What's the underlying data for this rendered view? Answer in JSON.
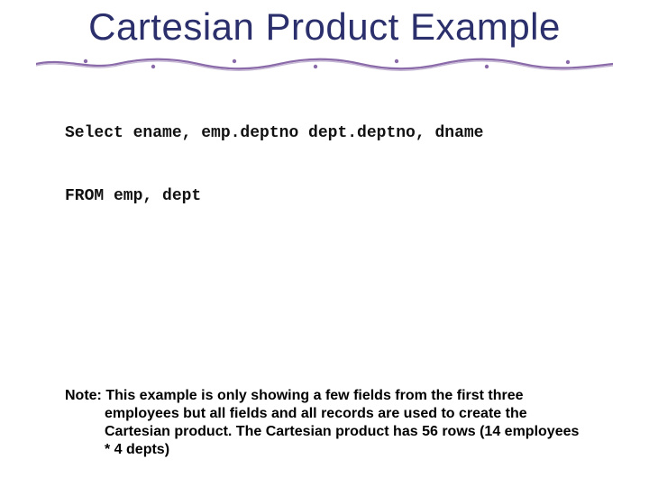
{
  "title": "Cartesian Product Example",
  "code": {
    "line1": "Select ename, emp.deptno dept.deptno, dname",
    "line2": "FROM emp, dept"
  },
  "note": "Note: This example is only showing a few fields from the first three employees but all fields and all records are used to create the Cartesian product.  The Cartesian product has 56 rows (14 employees * 4 depts)",
  "colors": {
    "title": "#2b2f6c",
    "vine": "#8a6aa8"
  }
}
